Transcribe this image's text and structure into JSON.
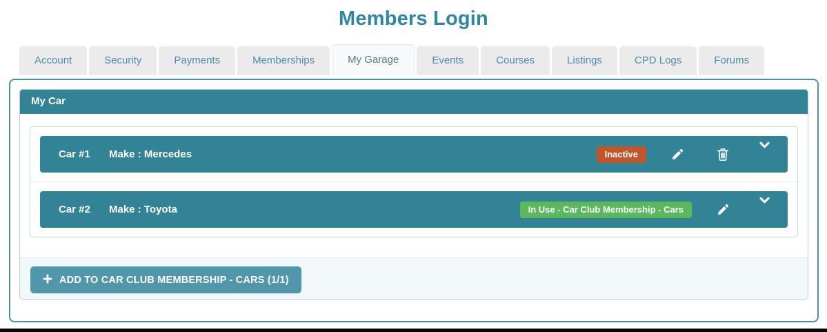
{
  "title": "Members Login",
  "tabs": {
    "active": "My Garage",
    "items": [
      {
        "label": "Account"
      },
      {
        "label": "Security"
      },
      {
        "label": "Payments"
      },
      {
        "label": "Memberships"
      },
      {
        "label": "My Garage"
      },
      {
        "label": "Events"
      },
      {
        "label": "Courses"
      },
      {
        "label": "Listings"
      },
      {
        "label": "CPD Logs"
      },
      {
        "label": "Forums"
      }
    ]
  },
  "garage": {
    "panel_title": "My Car",
    "cars": [
      {
        "label": "Car #1",
        "make": "Make : Mercedes",
        "status": {
          "text": "Inactive",
          "color": "#c1562d"
        }
      },
      {
        "label": "Car #2",
        "make": "Make : Toyota",
        "status": {
          "text": "In Use - Car Club Membership - Cars",
          "color": "#5cb85c"
        }
      }
    ],
    "add_button_label": "ADD TO CAR CLUB MEMBERSHIP - CARS (1/1)"
  },
  "colors": {
    "accent_teal": "#318395",
    "panel_border": "#4a93a6",
    "add_button": "#5097ab",
    "badge_inactive": "#c1562d",
    "badge_in_use": "#5cb85c",
    "title_text": "#2e86a3",
    "tab_text": "#4d8cab"
  }
}
